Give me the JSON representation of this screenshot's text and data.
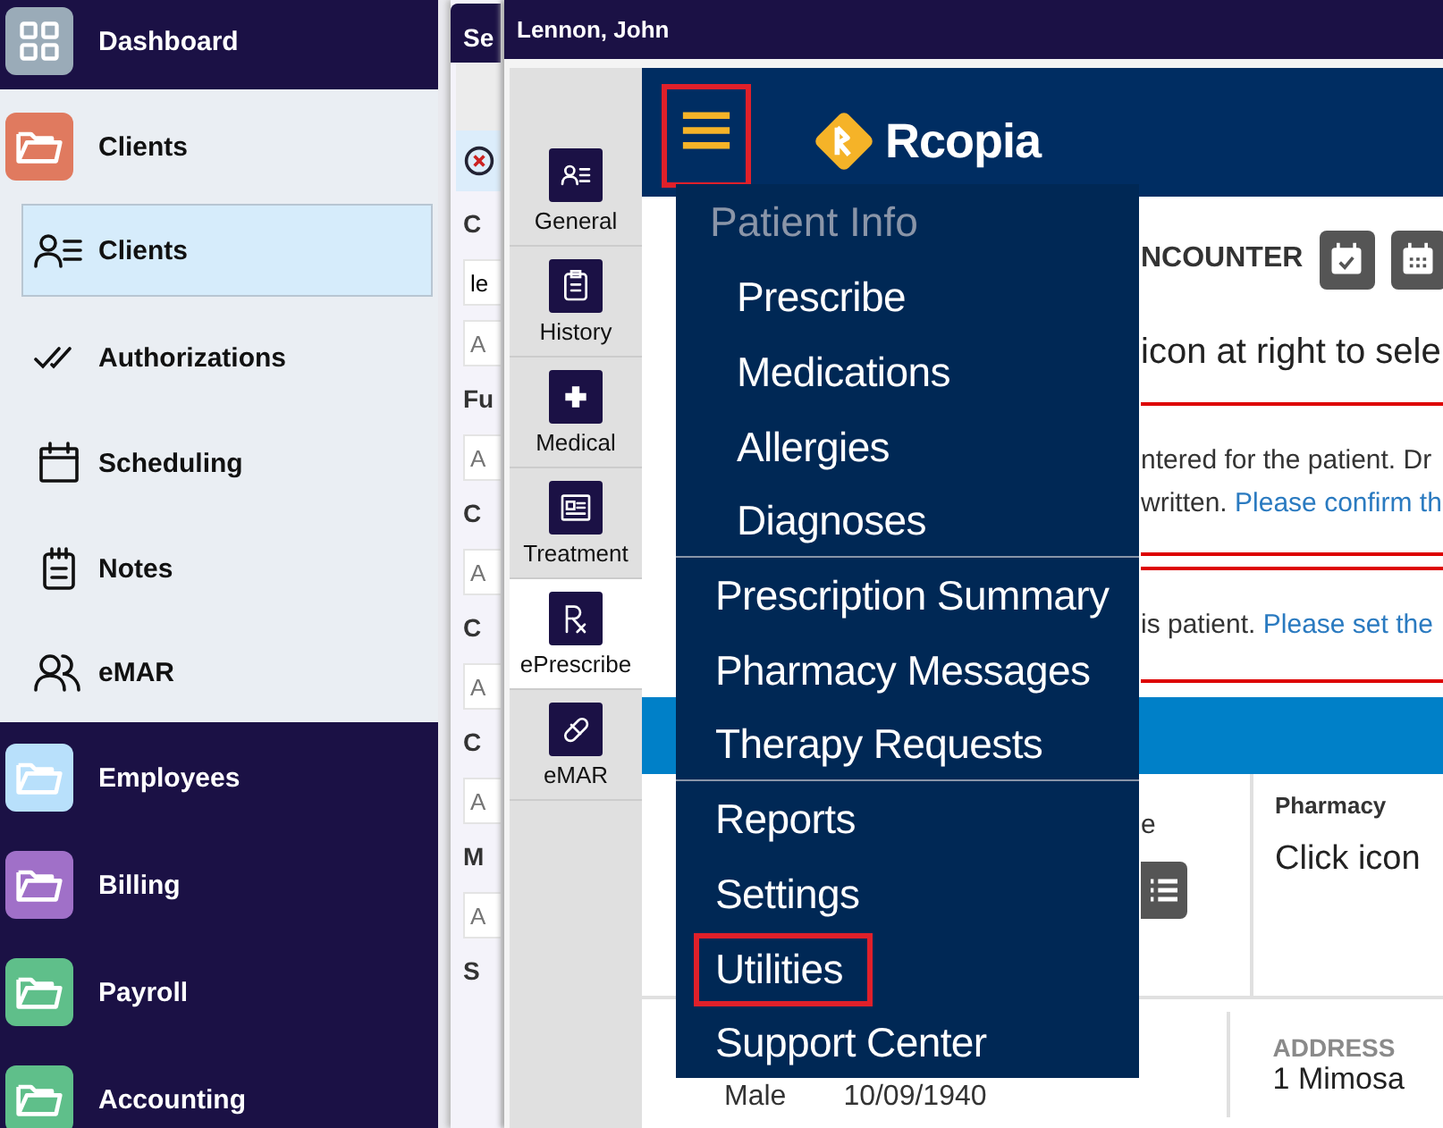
{
  "sidebar": {
    "items": [
      {
        "label": "Dashboard",
        "kind": "dashboard",
        "color": "#9aabb8",
        "expanded": false
      },
      {
        "label": "Clients",
        "kind": "group",
        "color": "#e07a5f",
        "expanded": true,
        "children": [
          {
            "label": "Clients",
            "selected": true
          },
          {
            "label": "Authorizations",
            "selected": false
          },
          {
            "label": "Scheduling",
            "selected": false
          },
          {
            "label": "Notes",
            "selected": false
          },
          {
            "label": "eMAR",
            "selected": false
          }
        ]
      },
      {
        "label": "Employees",
        "kind": "group",
        "color": "#b8e0fb",
        "expanded": false
      },
      {
        "label": "Billing",
        "kind": "group",
        "color": "#a070c8",
        "expanded": false
      },
      {
        "label": "Payroll",
        "kind": "group",
        "color": "#5fbf8a",
        "expanded": false
      },
      {
        "label": "Accounting",
        "kind": "group",
        "color": "#5fbf8a",
        "expanded": false
      }
    ]
  },
  "search_panel": {
    "title": "Se",
    "fields": [
      {
        "label": "C",
        "inputs": [
          {
            "value": "le"
          },
          {
            "placeholder": "A"
          }
        ]
      },
      {
        "label": "Fu",
        "inputs": [
          {
            "placeholder": "A"
          }
        ]
      },
      {
        "label": "C",
        "inputs": [
          {
            "placeholder": "A"
          }
        ]
      },
      {
        "label": "C",
        "inputs": [
          {
            "placeholder": "A"
          }
        ]
      },
      {
        "label": "C",
        "inputs": [
          {
            "placeholder": "A"
          }
        ]
      },
      {
        "label": "M",
        "inputs": [
          {
            "placeholder": "A"
          }
        ]
      },
      {
        "label": "S"
      }
    ]
  },
  "patient_window": {
    "title": "Lennon, John",
    "tabs": [
      {
        "label": "General",
        "selected": false
      },
      {
        "label": "History",
        "selected": false
      },
      {
        "label": "Medical",
        "selected": false
      },
      {
        "label": "Treatment",
        "selected": false
      },
      {
        "label": "ePrescribe",
        "selected": true
      },
      {
        "label": "eMAR",
        "selected": false
      }
    ],
    "rcopia": {
      "logo": "Rcopia",
      "menu_button": {
        "highlighted": true
      },
      "encounter_heading": "NCOUNTER",
      "prompt": "icon at right to sele",
      "alert_1": {
        "text": "ntered for the patient. Dr",
        "text_2": "written.",
        "link": "Please confirm th"
      },
      "alert_2": {
        "text": "is patient.",
        "link": "Please set the"
      },
      "cell_text": "e",
      "pharmacy": {
        "label": "Pharmacy",
        "value": "Click icon"
      },
      "demographics": {
        "gender": "Male",
        "dob": "10/09/1940",
        "address_label": "ADDRESS",
        "address": "1 Mimosa"
      },
      "menu": {
        "sections": [
          {
            "header": "Patient Info",
            "items": [
              {
                "label": "Prescribe",
                "highlighted": false
              },
              {
                "label": "Medications",
                "highlighted": false
              },
              {
                "label": "Allergies",
                "highlighted": false
              },
              {
                "label": "Diagnoses",
                "highlighted": false
              }
            ]
          },
          {
            "items": [
              {
                "label": "Prescription Summary",
                "highlighted": false
              },
              {
                "label": "Pharmacy Messages",
                "highlighted": false
              },
              {
                "label": "Therapy Requests",
                "highlighted": false
              }
            ]
          },
          {
            "items": [
              {
                "label": "Reports",
                "highlighted": false
              },
              {
                "label": "Settings",
                "highlighted": false
              },
              {
                "label": "Utilities",
                "highlighted": true
              },
              {
                "label": "Support Center",
                "highlighted": false
              }
            ]
          }
        ]
      }
    }
  }
}
